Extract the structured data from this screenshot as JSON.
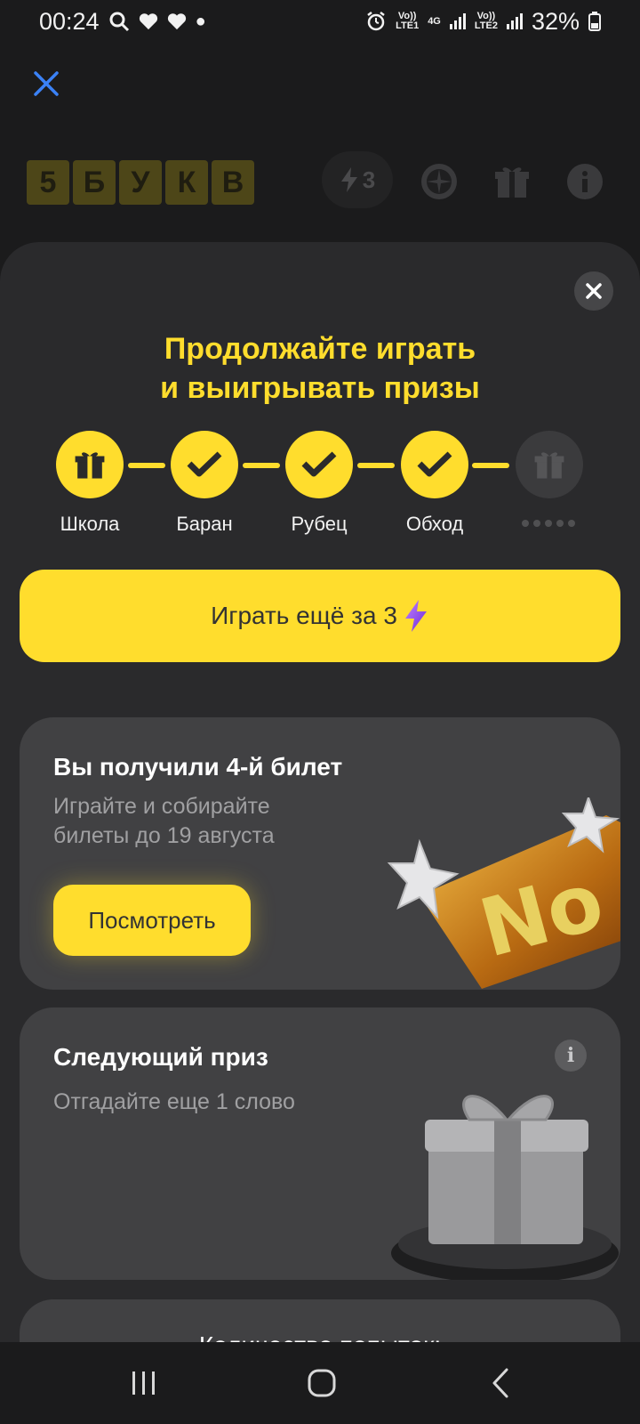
{
  "status_bar": {
    "time": "00:24",
    "battery": "32%",
    "lte1": "Vo))\nLTE1",
    "net": "4G",
    "lte2": "Vo))\nLTE2"
  },
  "app_header": {
    "logo_letters": [
      "5",
      "Б",
      "У",
      "К",
      "В"
    ],
    "energy_count": "3"
  },
  "sheet": {
    "title_line1": "Продолжайте играть",
    "title_line2": "и выигрывать призы",
    "steps": [
      {
        "label": "Школа",
        "state": "gift"
      },
      {
        "label": "Баран",
        "state": "done"
      },
      {
        "label": "Рубец",
        "state": "done"
      },
      {
        "label": "Обход",
        "state": "done"
      },
      {
        "label": "",
        "state": "locked"
      }
    ],
    "play_button": "Играть ещё за 3",
    "ticket_card": {
      "title": "Вы получили 4-й билет",
      "subtitle_line1": "Играйте и собирайте",
      "subtitle_line2": "билеты до 19 августа",
      "button": "Посмотреть"
    },
    "prize_card": {
      "title": "Следующий приз",
      "subtitle": "Отгадайте еще 1 слово"
    },
    "attempts_card": {
      "title": "Количество попыток:"
    }
  },
  "colors": {
    "accent": "#ffdd2d",
    "sheet_bg": "#2a2a2c",
    "card_bg": "#414143"
  }
}
